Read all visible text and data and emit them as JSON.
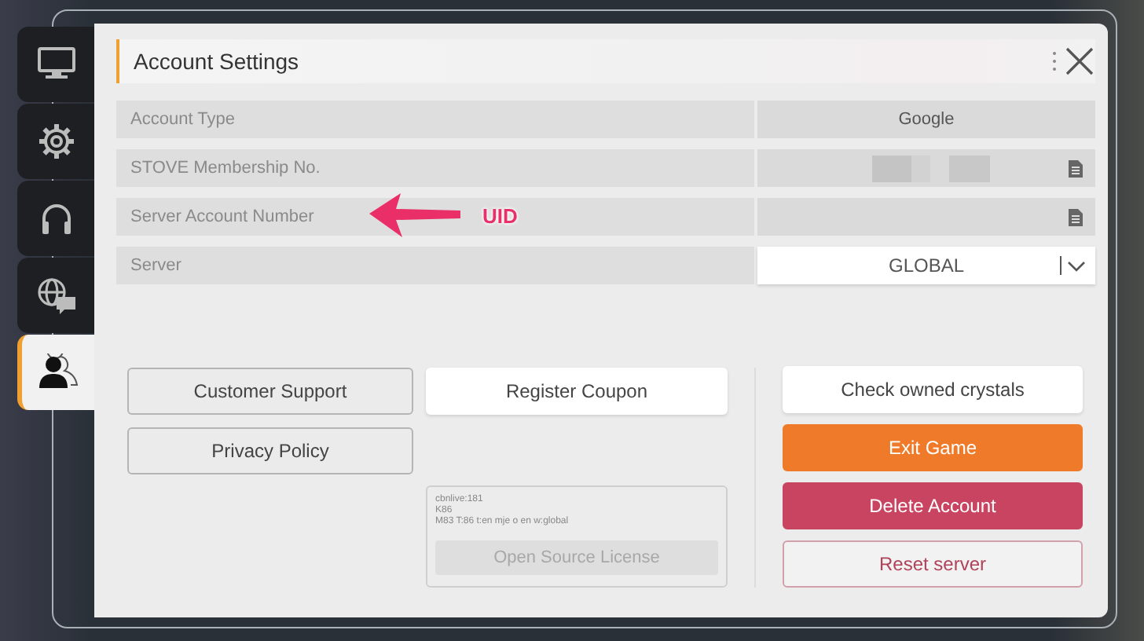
{
  "sidebar": {
    "tabs": [
      {
        "kind": "monitor",
        "selected": false
      },
      {
        "kind": "gear",
        "selected": false
      },
      {
        "kind": "headphones",
        "selected": false
      },
      {
        "kind": "globe-chat",
        "selected": false
      },
      {
        "kind": "person",
        "selected": true
      }
    ]
  },
  "panel": {
    "title": "Account Settings",
    "rows": [
      {
        "kind": "text",
        "label": "Account Type",
        "value": "Google"
      },
      {
        "kind": "redacted-copy",
        "label": "STOVE Membership No."
      },
      {
        "kind": "copy",
        "label": "Server Account Number",
        "annotation": "UID"
      },
      {
        "kind": "dropdown",
        "label": "Server",
        "value": "GLOBAL"
      }
    ],
    "buttons_left": [
      {
        "label": "Customer Support",
        "kind": "outline"
      },
      {
        "label": "Privacy Policy",
        "kind": "outline"
      }
    ],
    "coupon_button": {
      "label": "Register Coupon",
      "kind": "plain"
    },
    "version_info": {
      "lines": [
        "cbnlive:181",
        "K86",
        "M83 T:86 t:en mje o en w:global"
      ],
      "button": "Open Source License"
    },
    "buttons_right": [
      {
        "label": "Check owned crystals",
        "kind": "plain"
      },
      {
        "label": "Exit Game",
        "kind": "primary"
      },
      {
        "label": "Delete Account",
        "kind": "danger"
      },
      {
        "label": "Reset server",
        "kind": "danger-outline"
      }
    ]
  }
}
